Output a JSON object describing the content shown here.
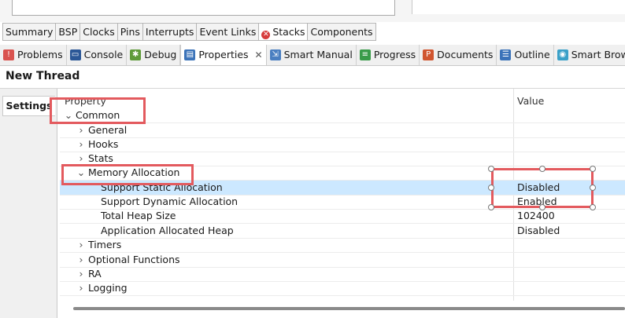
{
  "editor_tabs": [
    {
      "label": "Summary"
    },
    {
      "label": "BSP"
    },
    {
      "label": "Clocks"
    },
    {
      "label": "Pins"
    },
    {
      "label": "Interrupts"
    },
    {
      "label": "Event Links"
    },
    {
      "label": "Stacks",
      "icon": "error-icon",
      "active": true
    },
    {
      "label": "Components"
    }
  ],
  "view_tabs": [
    {
      "label": "Problems",
      "icon": "problems-icon"
    },
    {
      "label": "Console",
      "icon": "console-icon"
    },
    {
      "label": "Debug",
      "icon": "debug-icon"
    },
    {
      "label": "Properties",
      "icon": "properties-icon",
      "active": true,
      "close": "✕"
    },
    {
      "label": "Smart Manual",
      "icon": "smart-manual-icon"
    },
    {
      "label": "Progress",
      "icon": "progress-icon"
    },
    {
      "label": "Documents",
      "icon": "documents-icon"
    },
    {
      "label": "Outline",
      "icon": "outline-icon"
    },
    {
      "label": "Smart Browser",
      "icon": "smart-browser-icon"
    }
  ],
  "view": {
    "title": "New Thread",
    "left_tab": "Settings"
  },
  "table": {
    "col_property": "Property",
    "col_value": "Value",
    "rows": [
      {
        "label": "Common",
        "arrow": "⌄",
        "value": ""
      },
      {
        "label": "General",
        "arrow": "›",
        "value": ""
      },
      {
        "label": "Hooks",
        "arrow": "›",
        "value": ""
      },
      {
        "label": "Stats",
        "arrow": "›",
        "value": ""
      },
      {
        "label": "Memory Allocation",
        "arrow": "⌄",
        "value": ""
      },
      {
        "label": "Support Static Allocation",
        "arrow": "",
        "value": "Disabled",
        "selected": true
      },
      {
        "label": "Support Dynamic Allocation",
        "arrow": "",
        "value": "Enabled"
      },
      {
        "label": "Total Heap Size",
        "arrow": "",
        "value": "102400"
      },
      {
        "label": "Application Allocated Heap",
        "arrow": "",
        "value": "Disabled"
      },
      {
        "label": "Timers",
        "arrow": "›",
        "value": ""
      },
      {
        "label": "Optional Functions",
        "arrow": "›",
        "value": ""
      },
      {
        "label": "RA",
        "arrow": "›",
        "value": ""
      },
      {
        "label": "Logging",
        "arrow": "›",
        "value": ""
      }
    ]
  },
  "colors": {
    "annotation": "#e35a5e",
    "selection": "#cce8ff"
  }
}
